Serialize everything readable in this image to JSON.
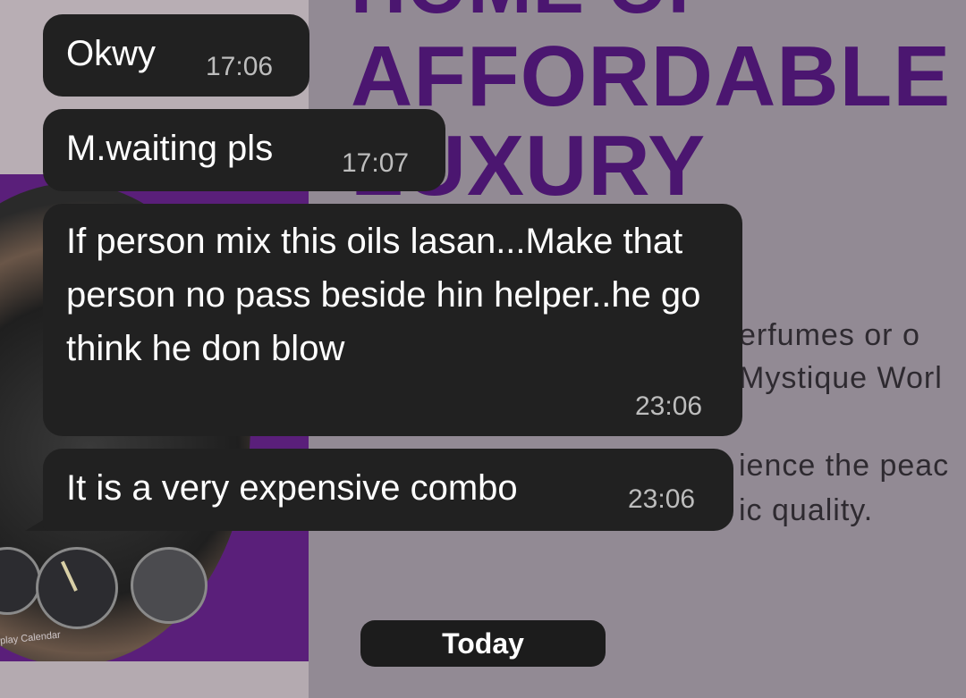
{
  "wallpaper": {
    "hero_lines": [
      "HOME OF",
      "AFFORDABLE",
      "LUXURY"
    ],
    "body_lines": [
      "erfumes or o",
      "Mystique Worl",
      "ience the peac",
      "ic quality."
    ],
    "watch_caption": "play Calendar",
    "colors": {
      "purple": "#5a1f7a",
      "hero_text": "#4b1670"
    }
  },
  "messages": [
    {
      "text": "Okwy",
      "time": "17:06"
    },
    {
      "text": "M.waiting pls",
      "time": "17:07"
    },
    {
      "text": "If person mix this oils lasan...Make that person no pass beside hin helper..he go think he don blow",
      "time": "23:06"
    },
    {
      "text": "It is a very expensive combo",
      "time": "23:06"
    }
  ],
  "date_divider": "Today",
  "colors": {
    "bubble": "#212121",
    "bubble_text": "#ffffff",
    "timestamp": "#bdbdbd"
  }
}
